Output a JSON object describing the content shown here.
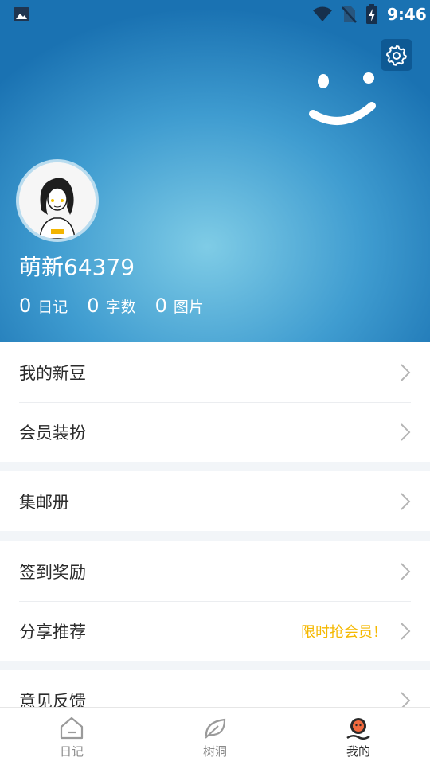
{
  "status_bar": {
    "time": "9:46",
    "icons": [
      "image-notification-icon",
      "wifi-icon",
      "no-sim-icon",
      "battery-charging-icon"
    ]
  },
  "profile": {
    "username": "萌新64379",
    "avatar": "avatar-girl-illustration",
    "stats": [
      {
        "value": "0",
        "label": "日记"
      },
      {
        "value": "0",
        "label": "字数"
      },
      {
        "value": "0",
        "label": "图片"
      }
    ]
  },
  "menu": {
    "section1": [
      {
        "label": "我的新豆"
      },
      {
        "label": "会员装扮"
      }
    ],
    "section2": [
      {
        "label": "集邮册"
      }
    ],
    "section3": [
      {
        "label": "签到奖励"
      },
      {
        "label": "分享推荐",
        "extra": "限时抢会员！"
      }
    ],
    "section4": [
      {
        "label": "意见反馈"
      }
    ]
  },
  "tabs": [
    {
      "label": "日记",
      "icon": "home-icon",
      "active": false
    },
    {
      "label": "树洞",
      "icon": "leaf-icon",
      "active": false
    },
    {
      "label": "我的",
      "icon": "mine-icon",
      "active": true
    }
  ],
  "colors": {
    "header_blue": "#3f9cd0",
    "promo_yellow": "#f5b800",
    "section_gap": "#f2f5f8"
  }
}
